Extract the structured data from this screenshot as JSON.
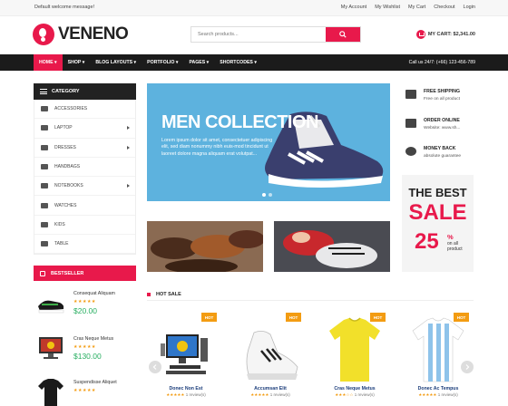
{
  "topbar": {
    "welcome": "Default welcome message!",
    "links": [
      "My Account",
      "My Wishlist",
      "My Cart",
      "Checkout",
      "Login"
    ]
  },
  "header": {
    "logo": "VENENO",
    "search_placeholder": "Search products...",
    "cart_label": "MY CART: $2,341.00"
  },
  "nav": {
    "items": [
      "HOME",
      "SHOP",
      "BLOG LAYOUTS",
      "PORTFOLIO",
      "PAGES",
      "SHORTCODES"
    ],
    "call": "Call us 24/7: (+66) 123-456-789"
  },
  "sidebar": {
    "category_title": "CATEGORY",
    "categories": [
      "ACCESSORIES",
      "LAPTOP",
      "DRESSES",
      "HANDBAGS",
      "NOTEBOOKS",
      "WATCHES",
      "KIDS",
      "TABLE"
    ],
    "bestseller_title": "BESTSELLER",
    "bestsellers": [
      {
        "name": "Consequat Aliquam",
        "stars": "★★★★★",
        "price": "$20.00"
      },
      {
        "name": "Cras Neque Metus",
        "stars": "★★★★★",
        "price": "$130.00"
      },
      {
        "name": "Suspendisse Aliquet",
        "stars": "★★★★★",
        "price": ""
      }
    ]
  },
  "banner": {
    "title": "MEN COLLECTION",
    "desc": "Lorem ipsum dolor sit amet, consectetuer adipiscing elit, sed diam nonummy nibh euis-mod tincidunt ut laoreet dolore magna aliquam erat volutpat..."
  },
  "services": [
    {
      "title": "FREE SHIPPING",
      "sub": "Free on all product"
    },
    {
      "title": "ORDER ONLINE",
      "sub": "Website: www.sh..."
    },
    {
      "title": "MONEY BACK",
      "sub": "absolute guarantee"
    }
  ],
  "sale": {
    "line1": "THE BEST",
    "line2": "SALE",
    "percent": "25",
    "percent_sign": "%",
    "off": "on all product"
  },
  "hot_sale": {
    "title": "HOT SALE",
    "tag": "HOT",
    "products": [
      {
        "name": "Donec Non Est",
        "rating": "1 review(s)"
      },
      {
        "name": "Accumsan Elit",
        "rating": "1 review(s)"
      },
      {
        "name": "Cras Neque Metus",
        "rating": "1 review(s)"
      },
      {
        "name": "Donec Ac Tempus",
        "rating": "1 review(s)"
      }
    ]
  },
  "colors": {
    "accent": "#e8194b",
    "dark": "#1b1b1b",
    "banner": "#5db2de",
    "price": "#27ae60",
    "star": "#f39c12"
  }
}
